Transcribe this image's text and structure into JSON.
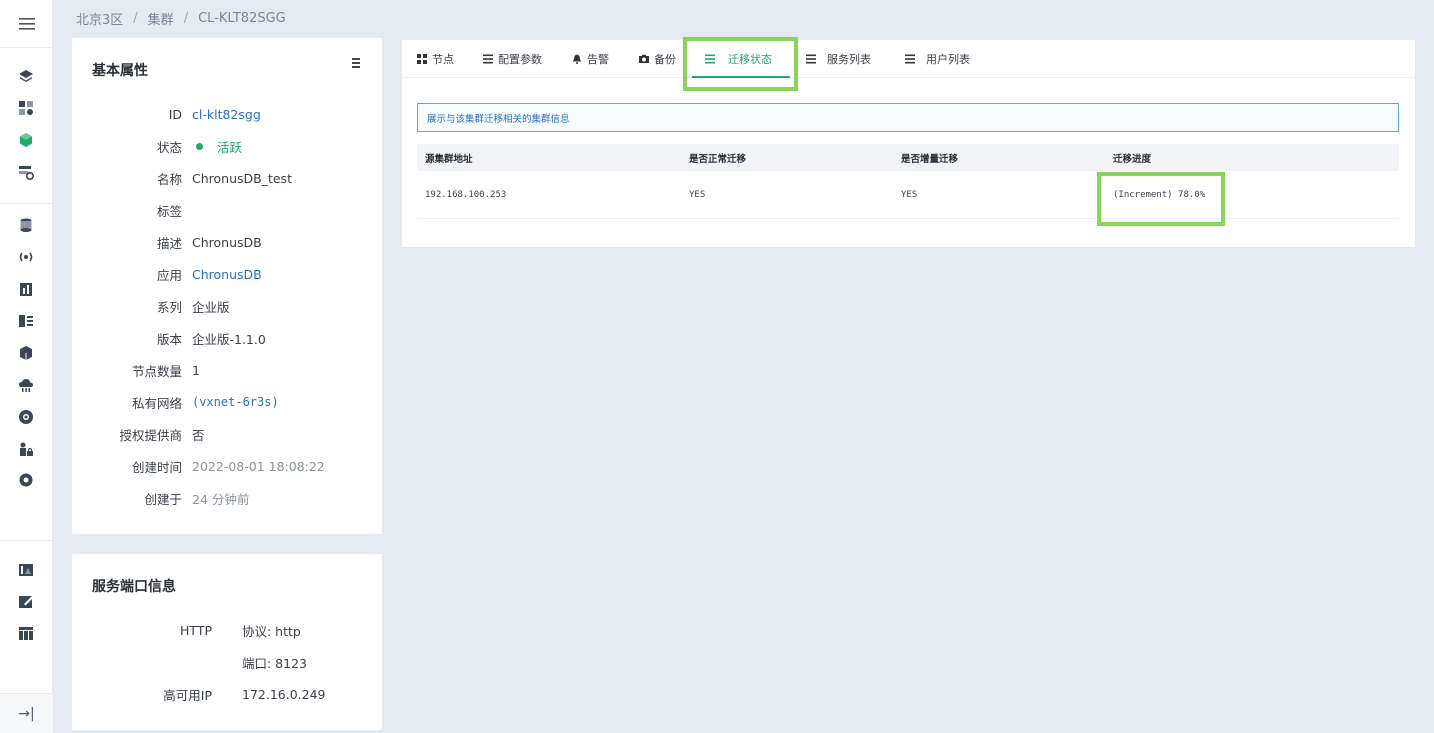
{
  "breadcrumb": [
    "北京3区",
    "集群",
    "CL-KLT82SGG"
  ],
  "sidebar": {
    "icons": [
      "layers-icon",
      "apps-settings-icon",
      "cube-icon",
      "storage-sync-icon",
      "database-icon",
      "broadcast-icon",
      "bar-chart-icon",
      "book-list-icon",
      "box-icon",
      "cloud-upload-icon",
      "disc-icon",
      "lock-user-icon",
      "shield-gear-icon",
      "bank-icon",
      "edit-image-icon",
      "table-icon"
    ],
    "collapse_label": "→|"
  },
  "basic": {
    "title": "基本属性",
    "rows": [
      {
        "key": "ID",
        "value": "cl-klt82sgg"
      },
      {
        "key": "状态",
        "value": "活跃"
      },
      {
        "key": "名称",
        "value": "ChronusDB_test"
      },
      {
        "key": "标签",
        "value": ""
      },
      {
        "key": "描述",
        "value": "ChronusDB"
      },
      {
        "key": "应用",
        "value": "ChronusDB"
      },
      {
        "key": "系列",
        "value": "企业版"
      },
      {
        "key": "版本",
        "value": "企业版-1.1.0"
      },
      {
        "key": "节点数量",
        "value": "1"
      },
      {
        "key": "私有网络",
        "value": "(vxnet-6r3s)"
      },
      {
        "key": "授权提供商",
        "value": "否"
      },
      {
        "key": "创建时间",
        "value": "2022-08-01 18:08:22"
      },
      {
        "key": "创建于",
        "value": "24 分钟前"
      }
    ]
  },
  "ports": {
    "title": "服务端口信息",
    "rows": [
      {
        "key": "HTTP",
        "value": "协议: http"
      },
      {
        "key": "",
        "value": "端口: 8123"
      },
      {
        "key": "高可用IP",
        "value": "172.16.0.249"
      }
    ]
  },
  "tabs": [
    {
      "label": "节点",
      "icon": "grid-icon"
    },
    {
      "label": "配置参数",
      "icon": "list-icon"
    },
    {
      "label": "告警",
      "icon": "bell-icon"
    },
    {
      "label": "备份",
      "icon": "camera-icon"
    },
    {
      "label": "迁移状态",
      "icon": "list-icon",
      "active": true
    },
    {
      "label": "服务列表",
      "icon": "list-icon"
    },
    {
      "label": "用户列表",
      "icon": "list-icon"
    }
  ],
  "info_text": "展示与该集群迁移相关的集群信息",
  "table": {
    "headers": [
      "源集群地址",
      "是否正常迁移",
      "是否增量迁移",
      "迁移进度"
    ],
    "rows": [
      [
        "192.168.100.253",
        "YES",
        "YES",
        "(Increment) 78.0%"
      ]
    ]
  },
  "colors": {
    "accent": "#1eaa6b",
    "highlight": "#8bd45a",
    "link": "#2a6fc1"
  }
}
